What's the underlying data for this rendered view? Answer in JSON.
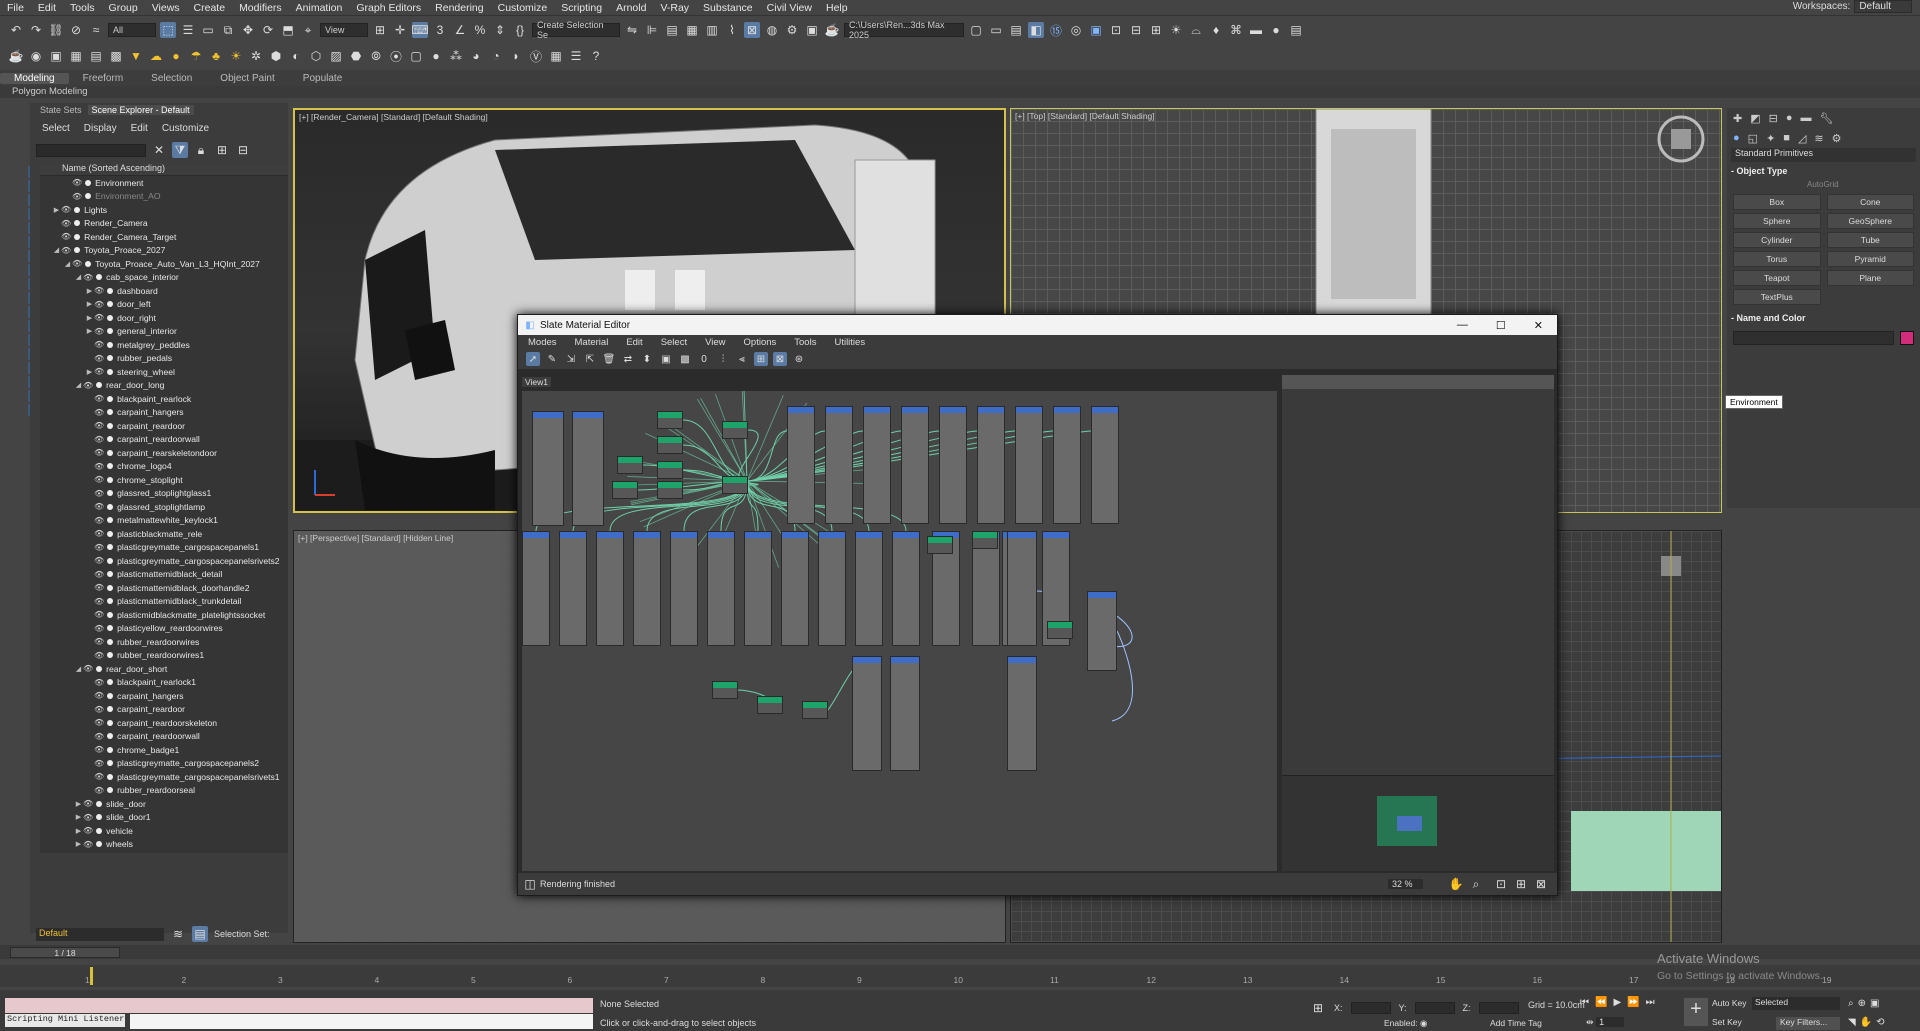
{
  "menubar": {
    "items": [
      "File",
      "Edit",
      "Tools",
      "Group",
      "Views",
      "Create",
      "Modifiers",
      "Animation",
      "Graph Editors",
      "Rendering",
      "Customize",
      "Scripting",
      "Arnold",
      "V-Ray",
      "Substance",
      "Civil View",
      "Help"
    ],
    "workspace_label": "Workspaces:",
    "workspace_value": "Default"
  },
  "toolbar": {
    "filter_value": "All",
    "view_value": "View",
    "selection_set_placeholder": "Create Selection Se",
    "path_value": "C:\\Users\\Ren...3ds Max 2025"
  },
  "ribbon": {
    "tabs": [
      "Modeling",
      "Freeform",
      "Selection",
      "Object Paint",
      "Populate"
    ],
    "active_tab": "Modeling",
    "sub_label": "Polygon Modeling"
  },
  "explorer": {
    "tabs": [
      "State Sets",
      "Scene Explorer - Default"
    ],
    "menus": [
      "Select",
      "Display",
      "Edit",
      "Customize"
    ],
    "header": "Name (Sorted Ascending)",
    "rows": [
      {
        "label": "Environment",
        "indent": 1,
        "expand": "",
        "dim": false
      },
      {
        "label": "Environment_AO",
        "indent": 1,
        "expand": "",
        "dim": true
      },
      {
        "label": "Lights",
        "indent": 0,
        "expand": "▶",
        "dim": false
      },
      {
        "label": "Render_Camera",
        "indent": 0,
        "expand": "",
        "dim": false
      },
      {
        "label": "Render_Camera_Target",
        "indent": 0,
        "expand": "",
        "dim": false
      },
      {
        "label": "Toyota_Proace_2027",
        "indent": 0,
        "expand": "◢",
        "dim": false
      },
      {
        "label": "Toyota_Proace_Auto_Van_L3_HQInt_2027",
        "indent": 1,
        "expand": "◢",
        "dim": false
      },
      {
        "label": "cab_space_interior",
        "indent": 2,
        "expand": "◢",
        "dim": false
      },
      {
        "label": "dashboard",
        "indent": 3,
        "expand": "▶",
        "dim": false
      },
      {
        "label": "door_left",
        "indent": 3,
        "expand": "▶",
        "dim": false
      },
      {
        "label": "door_right",
        "indent": 3,
        "expand": "▶",
        "dim": false
      },
      {
        "label": "general_interior",
        "indent": 3,
        "expand": "▶",
        "dim": false
      },
      {
        "label": "metalgrey_peddles",
        "indent": 3,
        "expand": "",
        "dim": false
      },
      {
        "label": "rubber_pedals",
        "indent": 3,
        "expand": "",
        "dim": false
      },
      {
        "label": "steering_wheel",
        "indent": 3,
        "expand": "▶",
        "dim": false
      },
      {
        "label": "rear_door_long",
        "indent": 2,
        "expand": "◢",
        "dim": false
      },
      {
        "label": "blackpaint_rearlock",
        "indent": 3,
        "expand": "",
        "dim": false
      },
      {
        "label": "carpaint_hangers",
        "indent": 3,
        "expand": "",
        "dim": false
      },
      {
        "label": "carpaint_reardoor",
        "indent": 3,
        "expand": "",
        "dim": false
      },
      {
        "label": "carpaint_reardoorwall",
        "indent": 3,
        "expand": "",
        "dim": false
      },
      {
        "label": "carpaint_rearskeletondoor",
        "indent": 3,
        "expand": "",
        "dim": false
      },
      {
        "label": "chrome_logo4",
        "indent": 3,
        "expand": "",
        "dim": false
      },
      {
        "label": "chrome_stoplight",
        "indent": 3,
        "expand": "",
        "dim": false
      },
      {
        "label": "glassred_stoplightglass1",
        "indent": 3,
        "expand": "",
        "dim": false
      },
      {
        "label": "glassred_stoplightlamp",
        "indent": 3,
        "expand": "",
        "dim": false
      },
      {
        "label": "metalmattewhite_keylock1",
        "indent": 3,
        "expand": "",
        "dim": false
      },
      {
        "label": "plasticblackmatte_rele",
        "indent": 3,
        "expand": "",
        "dim": false
      },
      {
        "label": "plasticgreymatte_cargospacepanels1",
        "indent": 3,
        "expand": "",
        "dim": false
      },
      {
        "label": "plasticgreymatte_cargospacepanelsrivets2",
        "indent": 3,
        "expand": "",
        "dim": false
      },
      {
        "label": "plasticmattemidblack_detail",
        "indent": 3,
        "expand": "",
        "dim": false
      },
      {
        "label": "plasticmattemidblack_doorhandle2",
        "indent": 3,
        "expand": "",
        "dim": false
      },
      {
        "label": "plasticmattemidblack_trunkdetail",
        "indent": 3,
        "expand": "",
        "dim": false
      },
      {
        "label": "plasticmidblackmatte_platelightssocket",
        "indent": 3,
        "expand": "",
        "dim": false
      },
      {
        "label": "plasticyellow_reardoorwires",
        "indent": 3,
        "expand": "",
        "dim": false
      },
      {
        "label": "rubber_reardoorwires",
        "indent": 3,
        "expand": "",
        "dim": false
      },
      {
        "label": "rubber_reardoorwires1",
        "indent": 3,
        "expand": "",
        "dim": false
      },
      {
        "label": "rear_door_short",
        "indent": 2,
        "expand": "◢",
        "dim": false
      },
      {
        "label": "blackpaint_rearlock1",
        "indent": 3,
        "expand": "",
        "dim": false
      },
      {
        "label": "carpaint_hangers",
        "indent": 3,
        "expand": "",
        "dim": false
      },
      {
        "label": "carpaint_reardoor",
        "indent": 3,
        "expand": "",
        "dim": false
      },
      {
        "label": "carpaint_reardoorskeleton",
        "indent": 3,
        "expand": "",
        "dim": false
      },
      {
        "label": "carpaint_reardoorwall",
        "indent": 3,
        "expand": "",
        "dim": false
      },
      {
        "label": "chrome_badge1",
        "indent": 3,
        "expand": "",
        "dim": false
      },
      {
        "label": "plasticgreymatte_cargospacepanels2",
        "indent": 3,
        "expand": "",
        "dim": false
      },
      {
        "label": "plasticgreymatte_cargospacepanelsrivets1",
        "indent": 3,
        "expand": "",
        "dim": false
      },
      {
        "label": "rubber_reardoorseal",
        "indent": 3,
        "expand": "",
        "dim": false
      },
      {
        "label": "slide_door",
        "indent": 2,
        "expand": "▶",
        "dim": false
      },
      {
        "label": "slide_door1",
        "indent": 2,
        "expand": "▶",
        "dim": false
      },
      {
        "label": "vehicle",
        "indent": 2,
        "expand": "▶",
        "dim": false
      },
      {
        "label": "wheels",
        "indent": 2,
        "expand": "▶",
        "dim": false
      }
    ],
    "layer_value": "Default",
    "selection_set_label": "Selection Set:"
  },
  "viewports": {
    "camera": "[+] [Render_Camera] [Standard] [Default Shading]",
    "top": "[+] [Top] [Standard] [Default Shading]",
    "perspective": "[+] [Perspective] [Standard] [Hidden Line]"
  },
  "command_panel": {
    "category": "Standard Primitives",
    "object_type_title": "Object Type",
    "autogrid": "AutoGrid",
    "buttons": [
      "Box",
      "Cone",
      "Sphere",
      "GeoSphere",
      "Cylinder",
      "Tube",
      "Torus",
      "Pyramid",
      "Teapot",
      "Plane",
      "TextPlus"
    ],
    "name_color_title": "Name and Color",
    "swatch_color": "#d22c7a",
    "tooltip": "Environment"
  },
  "slate": {
    "title": "Slate Material Editor",
    "menus": [
      "Modes",
      "Material",
      "Edit",
      "Select",
      "View",
      "Options",
      "Tools",
      "Utilities"
    ],
    "view_tab": "View1",
    "status": "Rendering finished",
    "zoom": "32 %"
  },
  "timeline": {
    "frame_label": "1 / 18",
    "ticks": [
      "1",
      "2",
      "3",
      "4",
      "5",
      "6",
      "7",
      "8",
      "9",
      "10",
      "11",
      "12",
      "13",
      "14",
      "15",
      "16",
      "17",
      "18",
      "19"
    ]
  },
  "status": {
    "script_listener": "Scripting Mini Listener",
    "selection": "None Selected",
    "hint": "Click or click-and-drag to select objects",
    "x_label": "X:",
    "y_label": "Y:",
    "z_label": "Z:",
    "grid": "Grid = 10.0cm",
    "enabled": "Enabled:",
    "add_time_tag": "Add Time Tag",
    "auto_key": "Auto Key",
    "set_key": "Set Key",
    "selected": "Selected",
    "key_filters": "Key Filters...",
    "frame_value": "1",
    "activate_title": "Activate Windows",
    "activate_sub": "Go to Settings to activate Windows."
  }
}
